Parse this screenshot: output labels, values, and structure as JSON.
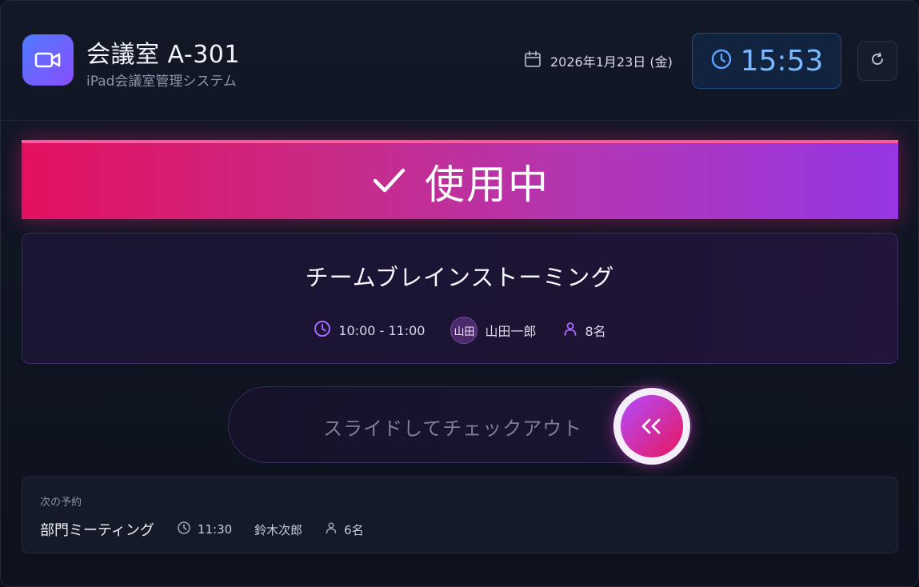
{
  "header": {
    "room_name": "会議室 A-301",
    "subtitle": "iPad会議室管理システム",
    "date": "2026年1月23日 (金)",
    "time": "15:53",
    "app_icon": "video-camera-icon",
    "refresh_icon": "refresh-icon"
  },
  "status": {
    "label": "使用中",
    "icon": "check-icon",
    "colors": {
      "start": "#e4105f",
      "end": "#9636e4"
    }
  },
  "current_meeting": {
    "title": "チームブレインストーミング",
    "time_range": "10:00 - 11:00",
    "organizer_initials": "山田",
    "organizer": "山田一郎",
    "attendees": "8名"
  },
  "checkout_slider": {
    "label": "スライドしてチェックアウト",
    "knob_icon": "double-chevron-left-icon"
  },
  "next_booking": {
    "section_label": "次の予約",
    "title": "部門ミーティング",
    "time": "11:30",
    "organizer": "鈴木次郎",
    "attendees": "6名"
  },
  "colors": {
    "accent_blue": "#7ab8ff",
    "accent_purple": "#a86bff",
    "background": "#0f1421"
  }
}
